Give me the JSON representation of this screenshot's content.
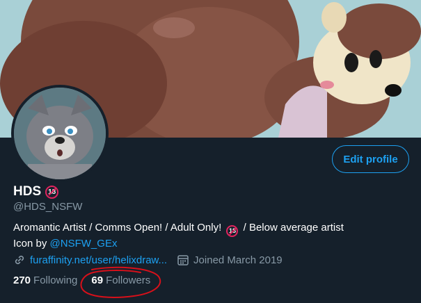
{
  "profile": {
    "edit_label": "Edit profile",
    "display_name": "HDS",
    "name_badge": "18",
    "handle": "@HDS_NSFW",
    "bio_line1_a": "Aromantic Artist / Comms Open! / Adult Only!",
    "bio_badge": "18",
    "bio_line1_b": "/ Below average artist",
    "bio_line2_prefix": "Icon by",
    "bio_mention": "@NSFW_GEx",
    "website": "furaffinity.net/user/helixdraw...",
    "joined": "Joined March 2019",
    "link_icon": "link-icon",
    "calendar_icon": "calendar-icon"
  },
  "stats": {
    "following_count": "270",
    "following_label": "Following",
    "followers_count": "69",
    "followers_label": "Followers"
  },
  "annotation": {
    "color": "#d8101a"
  },
  "colors": {
    "accent": "#1da1f2",
    "background": "#15202b",
    "muted": "#8899a6"
  }
}
